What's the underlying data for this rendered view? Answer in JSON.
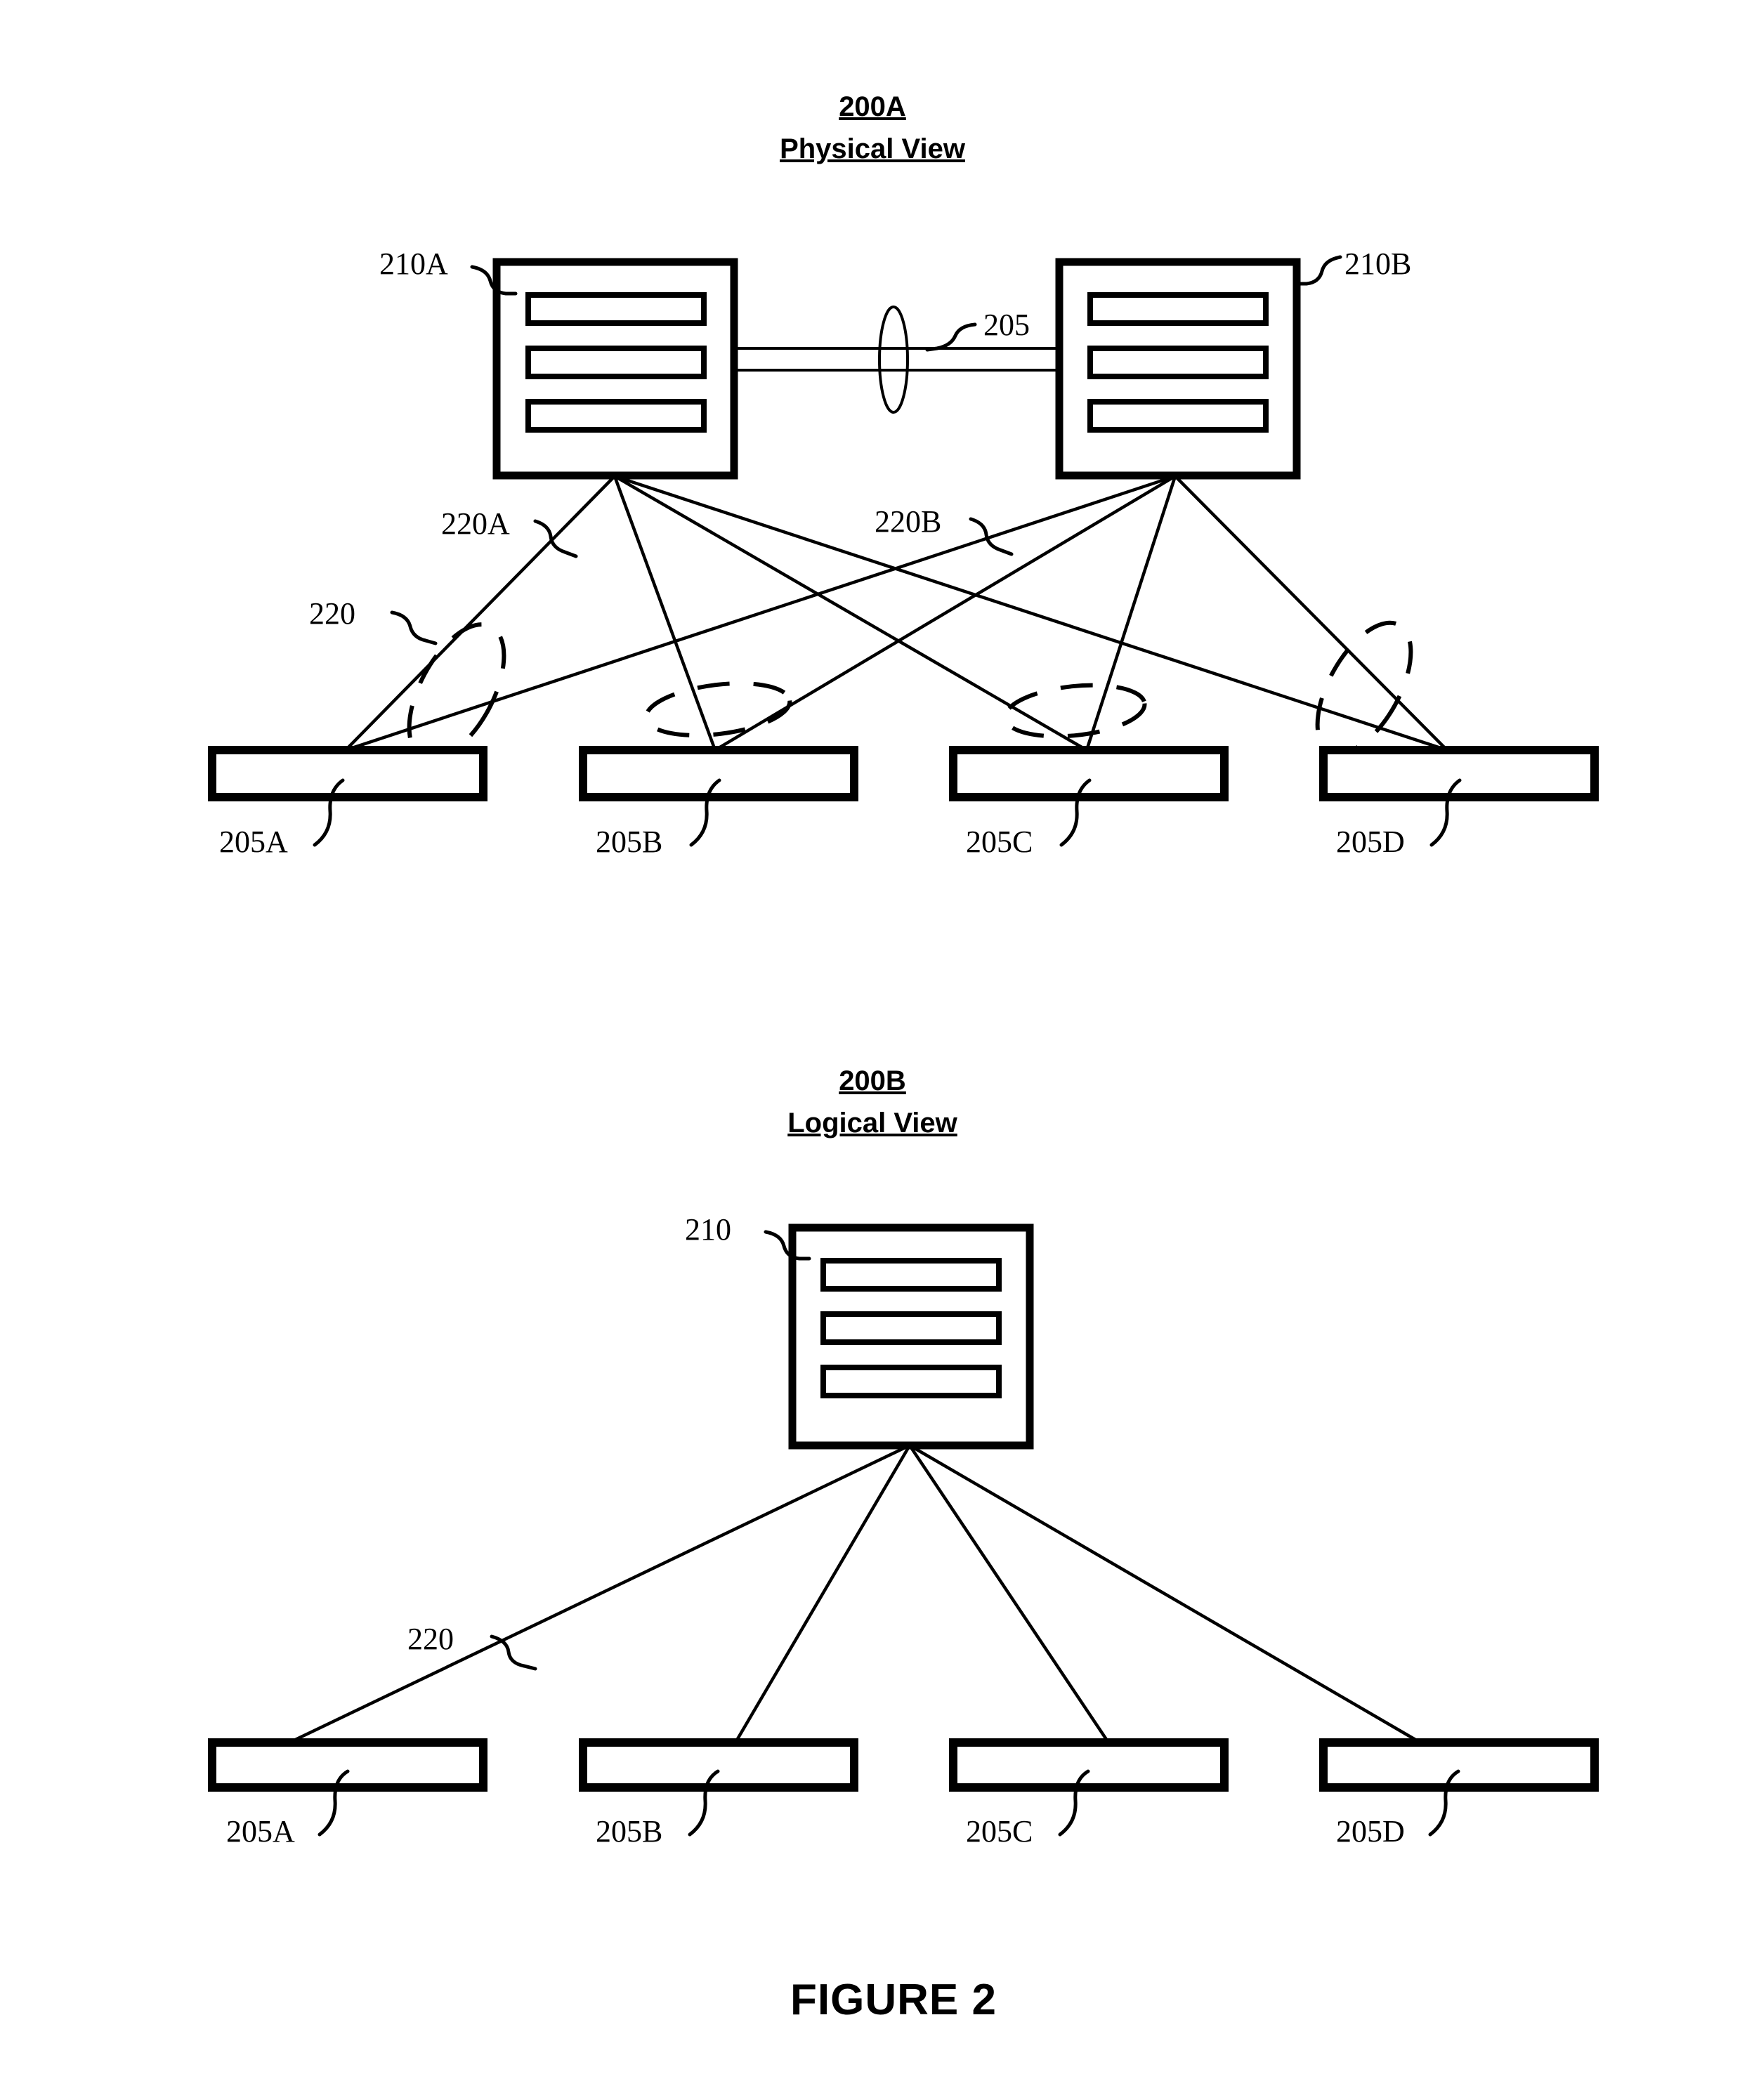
{
  "figure": {
    "caption": "FIGURE 2"
  },
  "panels": [
    {
      "id": "physical",
      "ref": "200A",
      "title": "Physical View",
      "nodes": [
        {
          "name": "controller-a",
          "ref": "210A",
          "slots": 3
        },
        {
          "name": "controller-b",
          "ref": "210B",
          "slots": 3
        }
      ],
      "link": {
        "ref": "205",
        "name": "inter-controller-link"
      },
      "connection_groups": [
        {
          "ref": "220A",
          "name": "connection-group-a"
        },
        {
          "ref": "220B",
          "name": "connection-group-b"
        }
      ],
      "wireless_region": {
        "ref": "220",
        "name": "wireless-coverage-region"
      },
      "devices": [
        {
          "ref": "205A",
          "name": "device-205a"
        },
        {
          "ref": "205B",
          "name": "device-205b"
        },
        {
          "ref": "205C",
          "name": "device-205c"
        },
        {
          "ref": "205D",
          "name": "device-205d"
        }
      ]
    },
    {
      "id": "logical",
      "ref": "200B",
      "title": "Logical View",
      "nodes": [
        {
          "name": "controller",
          "ref": "210",
          "slots": 3
        }
      ],
      "connection_groups": [
        {
          "ref": "220",
          "name": "connection-group"
        }
      ],
      "devices": [
        {
          "ref": "205A",
          "name": "device-205a"
        },
        {
          "ref": "205B",
          "name": "device-205b"
        },
        {
          "ref": "205C",
          "name": "device-205c"
        },
        {
          "ref": "205D",
          "name": "device-205d"
        }
      ]
    }
  ],
  "colors": {
    "ink": "#000000",
    "paper": "#ffffff"
  }
}
